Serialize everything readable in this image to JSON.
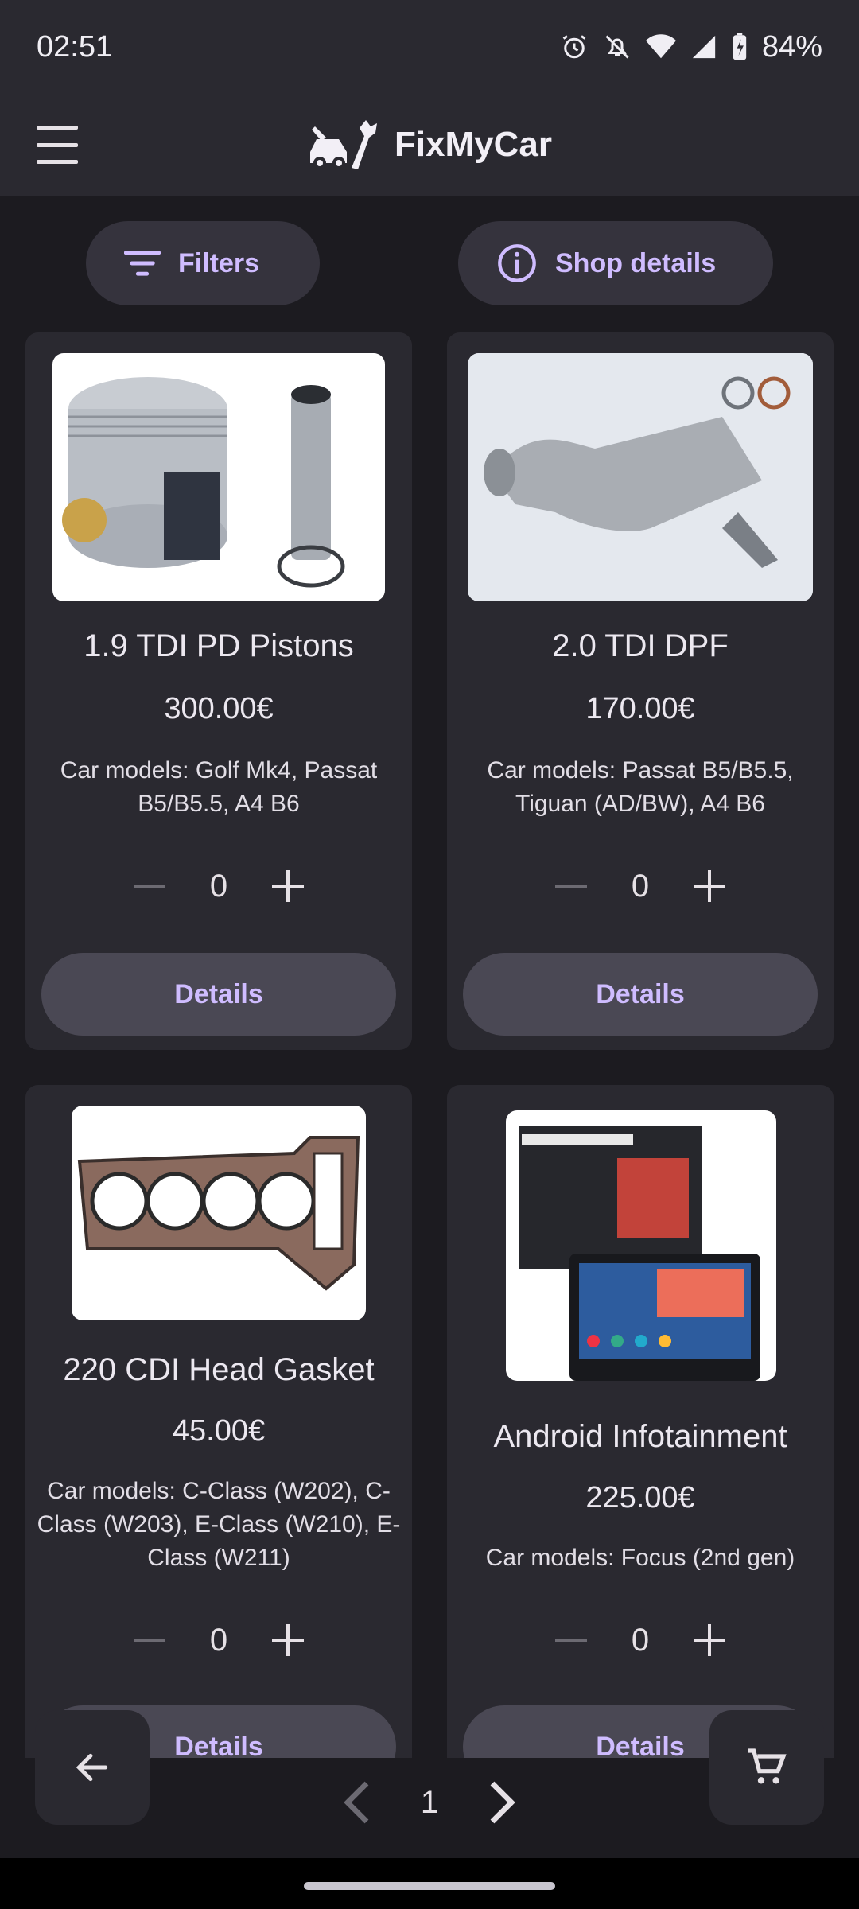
{
  "status": {
    "time": "02:51",
    "battery": "84%"
  },
  "app": {
    "title": "FixMyCar"
  },
  "toolbar": {
    "filters_label": "Filters",
    "shop_details_label": "Shop details"
  },
  "products": [
    {
      "name": "1.9 TDI PD Pistons",
      "price": "300.00€",
      "models": "Car models: Golf Mk4, Passat B5/B5.5, A4 B6",
      "quantity": "0",
      "details_label": "Details"
    },
    {
      "name": "2.0 TDI DPF",
      "price": "170.00€",
      "models": "Car models: Passat B5/B5.5, Tiguan (AD/BW), A4 B6",
      "quantity": "0",
      "details_label": "Details"
    },
    {
      "name": "220 CDI Head Gasket",
      "price": "45.00€",
      "models": "Car models: C-Class (W202), C-Class (W203), E-Class (W210), E-Class (W211)",
      "quantity": "0",
      "details_label": "Details"
    },
    {
      "name": "Android Infotainment",
      "price": "225.00€",
      "models": "Car models: Focus (2nd gen)",
      "quantity": "0",
      "details_label": "Details"
    }
  ],
  "pagination": {
    "page": "1"
  },
  "colors": {
    "accent": "#cfbcff",
    "surface": "#2a2930",
    "background": "#1c1b20"
  }
}
